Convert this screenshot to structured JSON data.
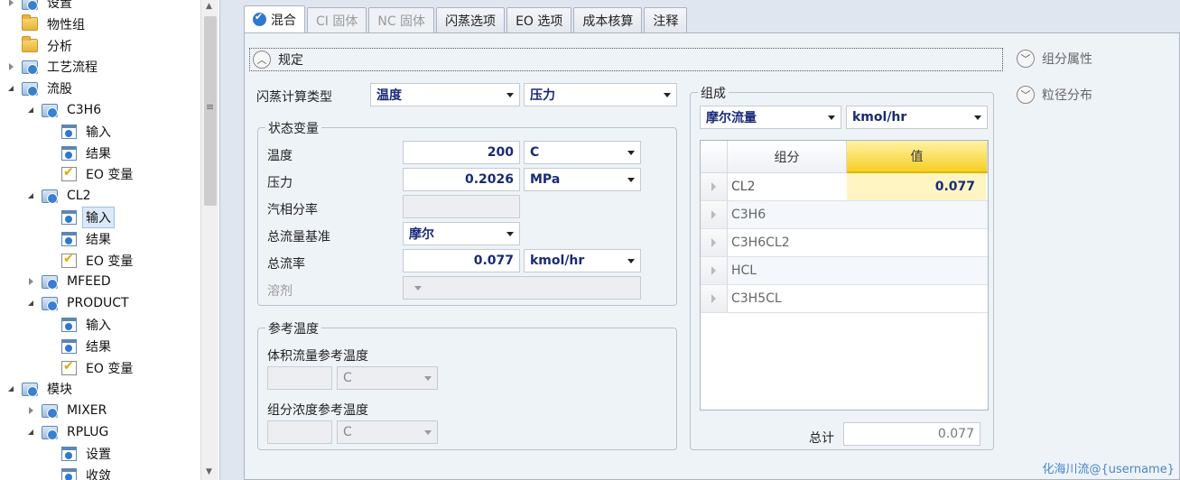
{
  "tree": [
    {
      "label": "设置",
      "icon": "folder-check-icon",
      "twisty": "closed",
      "indent": 0
    },
    {
      "label": "物性组",
      "icon": "folder-icon",
      "twisty": "none",
      "indent": 0
    },
    {
      "label": "分析",
      "icon": "folder-icon",
      "twisty": "none",
      "indent": 0
    },
    {
      "label": "工艺流程",
      "icon": "folder-check-icon",
      "twisty": "closed",
      "indent": 0
    },
    {
      "label": "流股",
      "icon": "folder-check-icon",
      "twisty": "open",
      "indent": 0
    },
    {
      "label": "C3H6",
      "icon": "folder-check-icon",
      "twisty": "open",
      "indent": 1
    },
    {
      "label": "输入",
      "icon": "form-check-icon",
      "twisty": "none",
      "indent": 2
    },
    {
      "label": "结果",
      "icon": "form-check-icon",
      "twisty": "none",
      "indent": 2
    },
    {
      "label": "EO 变量",
      "icon": "eo-check-icon",
      "twisty": "none",
      "indent": 2
    },
    {
      "label": "CL2",
      "icon": "folder-check-icon",
      "twisty": "open",
      "indent": 1
    },
    {
      "label": "输入",
      "icon": "form-check-icon",
      "twisty": "none",
      "indent": 2,
      "selected": true
    },
    {
      "label": "结果",
      "icon": "form-check-icon",
      "twisty": "none",
      "indent": 2
    },
    {
      "label": "EO 变量",
      "icon": "eo-check-icon",
      "twisty": "none",
      "indent": 2
    },
    {
      "label": "MFEED",
      "icon": "folder-check-icon",
      "twisty": "closed",
      "indent": 1
    },
    {
      "label": "PRODUCT",
      "icon": "folder-check-icon",
      "twisty": "open",
      "indent": 1
    },
    {
      "label": "输入",
      "icon": "form-check-icon",
      "twisty": "none",
      "indent": 2
    },
    {
      "label": "结果",
      "icon": "form-check-icon",
      "twisty": "none",
      "indent": 2
    },
    {
      "label": "EO 变量",
      "icon": "eo-check-icon",
      "twisty": "none",
      "indent": 2
    },
    {
      "label": "模块",
      "icon": "folder-check-icon",
      "twisty": "open",
      "indent": 0
    },
    {
      "label": "MIXER",
      "icon": "folder-check-icon",
      "twisty": "closed",
      "indent": 1
    },
    {
      "label": "RPLUG",
      "icon": "folder-check-icon",
      "twisty": "open",
      "indent": 1
    },
    {
      "label": "设置",
      "icon": "form-check-icon",
      "twisty": "none",
      "indent": 2
    },
    {
      "label": "收敛",
      "icon": "form-check-icon",
      "twisty": "none",
      "indent": 2
    }
  ],
  "tabs": [
    {
      "label": "混合",
      "state": "active"
    },
    {
      "label": "CI 固体",
      "state": "disabled"
    },
    {
      "label": "NC 固体",
      "state": "disabled"
    },
    {
      "label": "闪蒸选项",
      "state": "normal"
    },
    {
      "label": "EO 选项",
      "state": "normal"
    },
    {
      "label": "成本核算",
      "state": "normal"
    },
    {
      "label": "注释",
      "state": "normal"
    }
  ],
  "spec": {
    "header": "规定"
  },
  "side_links": {
    "component_attr": "组分属性",
    "psd": "粒径分布"
  },
  "flash": {
    "label": "闪蒸计算类型",
    "var1": "温度",
    "var2": "压力"
  },
  "state_vars": {
    "title": "状态变量",
    "temperature": {
      "label": "温度",
      "value": "200",
      "unit": "C"
    },
    "pressure": {
      "label": "压力",
      "value": "0.2026",
      "unit": "MPa"
    },
    "vapor_fraction": {
      "label": "汽相分率"
    },
    "flow_basis": {
      "label": "总流量基准",
      "value": "摩尔"
    },
    "total_flow": {
      "label": "总流率",
      "value": "0.077",
      "unit": "kmol/hr"
    },
    "solvent": {
      "label": "溶剂"
    }
  },
  "ref_temp": {
    "title": "参考温度",
    "vol_flow_label": "体积流量参考温度",
    "vol_flow_unit": "C",
    "comp_conc_label": "组分浓度参考温度",
    "comp_conc_unit": "C"
  },
  "composition": {
    "title": "组成",
    "basis": "摩尔流量",
    "unit": "kmol/hr",
    "col_component": "组分",
    "col_value": "值",
    "rows": [
      {
        "component": "CL2",
        "value": "0.077"
      },
      {
        "component": "C3H6",
        "value": ""
      },
      {
        "component": "C3H6CL2",
        "value": ""
      },
      {
        "component": "HCL",
        "value": ""
      },
      {
        "component": "C3H5CL",
        "value": ""
      }
    ],
    "total_label": "总计",
    "total_value": "0.077"
  },
  "watermark": "化海川流@{username}"
}
